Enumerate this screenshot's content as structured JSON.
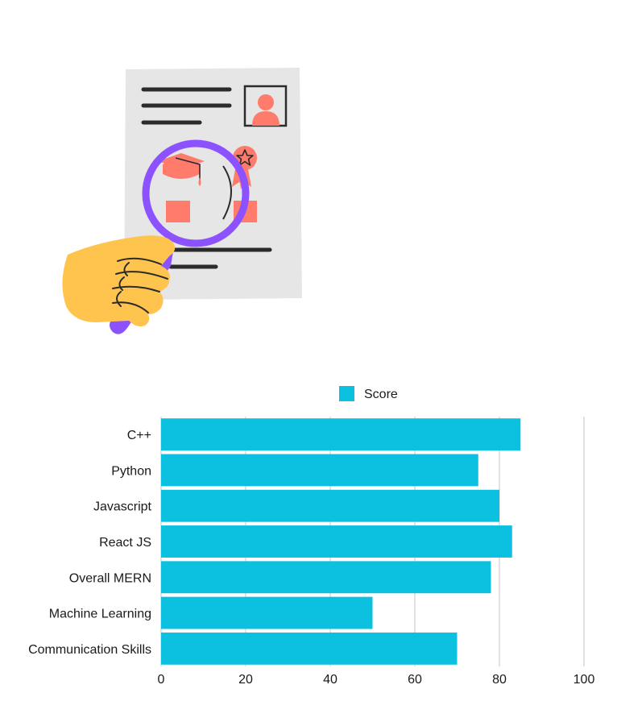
{
  "illustration": {
    "description_icon": "resume-magnifier-icon"
  },
  "colors": {
    "bar": "#0cc0df",
    "grid": "#d9d9d9",
    "paper": "#e6e6e6",
    "accent": "#ff7b6b",
    "magnifier": "#8c52ff",
    "hand": "#ffc44d",
    "ink": "#2b2b2b"
  },
  "chart_data": {
    "type": "bar",
    "orientation": "horizontal",
    "categories": [
      "C++",
      "Python",
      "Javascript",
      "React JS",
      "Overall MERN",
      "Machine Learning",
      "Communication Skills"
    ],
    "series": [
      {
        "name": "Score",
        "values": [
          85,
          75,
          80,
          83,
          78,
          50,
          70
        ]
      }
    ],
    "xlim": [
      0,
      100
    ],
    "xticks": [
      "0",
      "20",
      "40",
      "60",
      "80",
      "100"
    ],
    "title": "",
    "xlabel": "",
    "ylabel": "",
    "legend": "top-center",
    "grid": true
  }
}
